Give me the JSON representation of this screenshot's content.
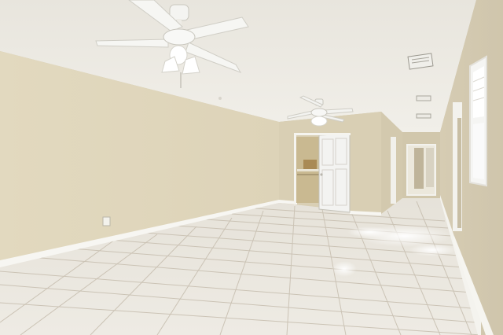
{
  "photo": {
    "subject": "empty-room-interior",
    "colors": {
      "ceiling": "#ece9e1",
      "left_wall": "#e4dcc2",
      "back_wall": "#d9cfb4",
      "right_wall": "#d8ceb6",
      "floor_tile": "#ebe7df",
      "grout": "#c9c2b4",
      "baseboard": "#f7f6f2",
      "door": "#f3f3f1",
      "fan_white": "#f8f8f6"
    },
    "objects": [
      "ceiling-fan-near",
      "ceiling-fan-far",
      "closet-door",
      "hallway-opening",
      "window-right",
      "air-vent",
      "wall-outlet"
    ]
  }
}
